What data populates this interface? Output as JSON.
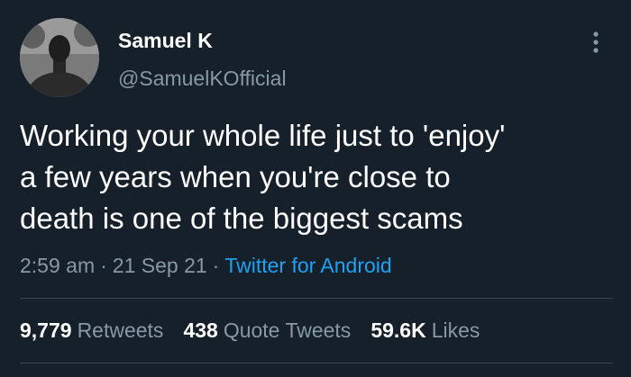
{
  "user": {
    "display_name": "Samuel K",
    "handle": "@SamuelKOfficial",
    "avatar_icon": "profile-photo"
  },
  "tweet": {
    "text_lines": [
      "Working your whole life just to 'enjoy'",
      "a few years when you're close to",
      "death is one of the biggest scams"
    ],
    "time": "2:59 am",
    "separator": "·",
    "date": "21 Sep 21",
    "source": "Twitter for Android"
  },
  "stats": {
    "retweets_count": "9,779",
    "retweets_label": "Retweets",
    "quotes_count": "438",
    "quotes_label": "Quote Tweets",
    "likes_count": "59.6K",
    "likes_label": "Likes"
  },
  "menu": {
    "more_icon": "more-vertical-icon"
  },
  "colors": {
    "background": "#15202b",
    "text_primary": "#ffffff",
    "text_secondary": "#8899a6",
    "accent": "#1da1f2",
    "divider": "#38444d"
  }
}
